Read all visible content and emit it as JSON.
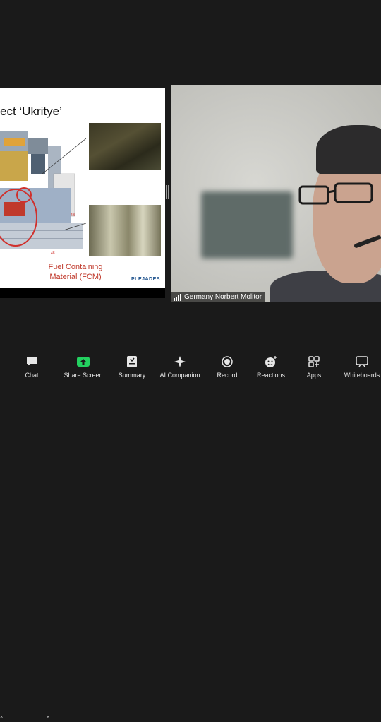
{
  "slide": {
    "title": "ect ‘Ukritye’",
    "fcm_line1": "Fuel Containing",
    "fcm_line2": "Material (FCM)",
    "logo": "PLEJADES"
  },
  "participant": {
    "name": "Germany Norbert Molitor"
  },
  "toolbar": {
    "items": [
      {
        "label": "Chat",
        "icon": "chat-icon"
      },
      {
        "label": "Share Screen",
        "icon": "share-screen-icon"
      },
      {
        "label": "Summary",
        "icon": "summary-icon"
      },
      {
        "label": "AI Companion",
        "icon": "ai-companion-icon"
      },
      {
        "label": "Record",
        "icon": "record-icon"
      },
      {
        "label": "Reactions",
        "icon": "reactions-icon"
      },
      {
        "label": "Apps",
        "icon": "apps-icon"
      },
      {
        "label": "Whiteboards",
        "icon": "whiteboards-icon"
      }
    ]
  },
  "colors": {
    "background": "#1a1a1a",
    "share_green": "#23d160",
    "fcm_red": "#c0392b"
  }
}
